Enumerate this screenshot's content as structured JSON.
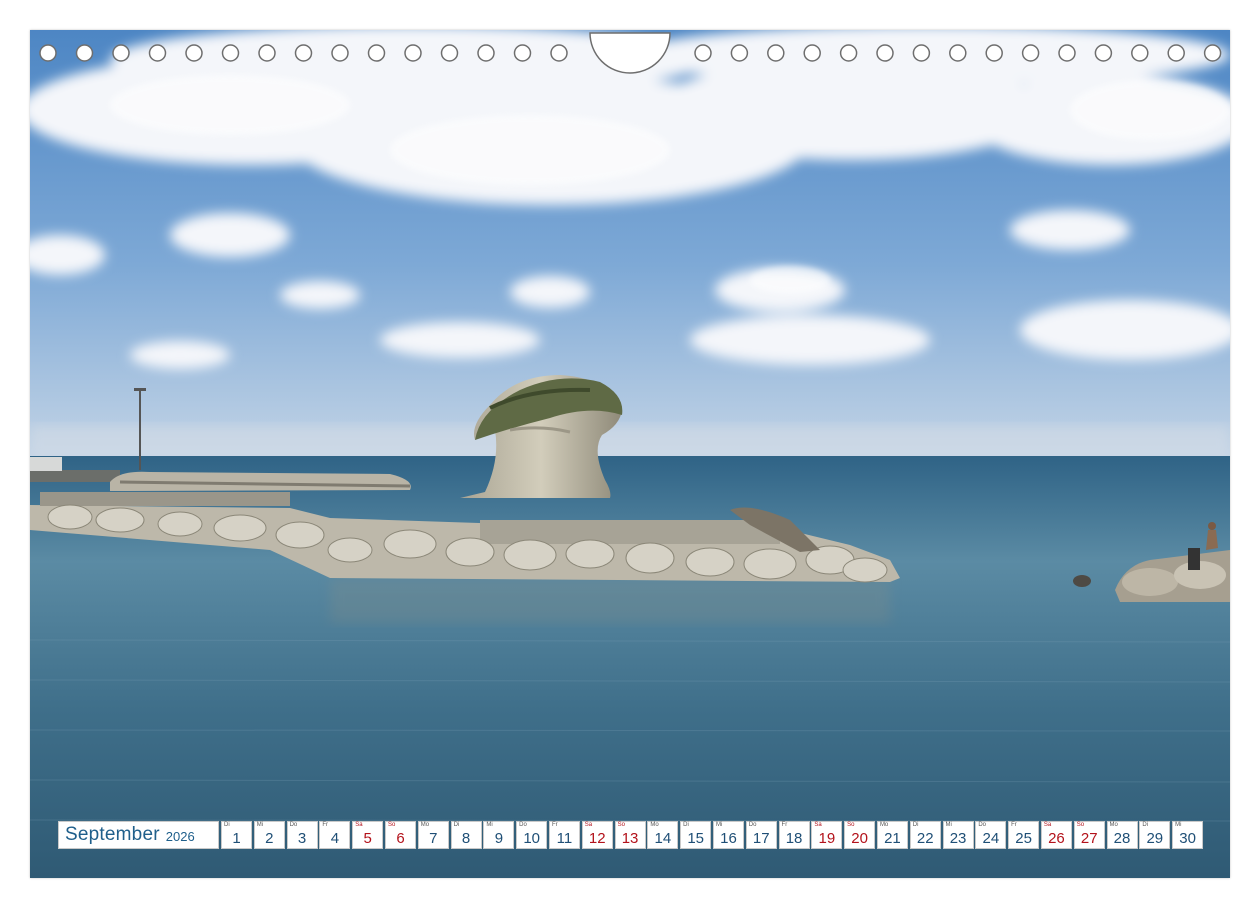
{
  "calendar": {
    "month": "September",
    "year": "2026",
    "days": [
      {
        "wd": "Di",
        "n": "1",
        "weekend": false
      },
      {
        "wd": "Mi",
        "n": "2",
        "weekend": false
      },
      {
        "wd": "Do",
        "n": "3",
        "weekend": false
      },
      {
        "wd": "Fr",
        "n": "4",
        "weekend": false
      },
      {
        "wd": "Sa",
        "n": "5",
        "weekend": true
      },
      {
        "wd": "So",
        "n": "6",
        "weekend": true
      },
      {
        "wd": "Mo",
        "n": "7",
        "weekend": false
      },
      {
        "wd": "Di",
        "n": "8",
        "weekend": false
      },
      {
        "wd": "Mi",
        "n": "9",
        "weekend": false
      },
      {
        "wd": "Do",
        "n": "10",
        "weekend": false
      },
      {
        "wd": "Fr",
        "n": "11",
        "weekend": false
      },
      {
        "wd": "Sa",
        "n": "12",
        "weekend": true
      },
      {
        "wd": "So",
        "n": "13",
        "weekend": true
      },
      {
        "wd": "Mo",
        "n": "14",
        "weekend": false
      },
      {
        "wd": "Di",
        "n": "15",
        "weekend": false
      },
      {
        "wd": "Mi",
        "n": "16",
        "weekend": false
      },
      {
        "wd": "Do",
        "n": "17",
        "weekend": false
      },
      {
        "wd": "Fr",
        "n": "18",
        "weekend": false
      },
      {
        "wd": "Sa",
        "n": "19",
        "weekend": true
      },
      {
        "wd": "So",
        "n": "20",
        "weekend": true
      },
      {
        "wd": "Mo",
        "n": "21",
        "weekend": false
      },
      {
        "wd": "Di",
        "n": "22",
        "weekend": false
      },
      {
        "wd": "Mi",
        "n": "23",
        "weekend": false
      },
      {
        "wd": "Do",
        "n": "24",
        "weekend": false
      },
      {
        "wd": "Fr",
        "n": "25",
        "weekend": false
      },
      {
        "wd": "Sa",
        "n": "26",
        "weekend": true
      },
      {
        "wd": "So",
        "n": "27",
        "weekend": true
      },
      {
        "wd": "Mo",
        "n": "28",
        "weekend": false
      },
      {
        "wd": "Di",
        "n": "29",
        "weekend": false
      },
      {
        "wd": "Mi",
        "n": "30",
        "weekend": false
      }
    ]
  },
  "colors": {
    "sky": "#5b8fc7",
    "sea": "#3d6e8e",
    "weekday_number": "#1f4f76",
    "weekend_number": "#b3121b",
    "month_text": "#1f5f8b"
  },
  "icons": {
    "binding_hole": "circle",
    "hanger_notch": "half-circle"
  }
}
